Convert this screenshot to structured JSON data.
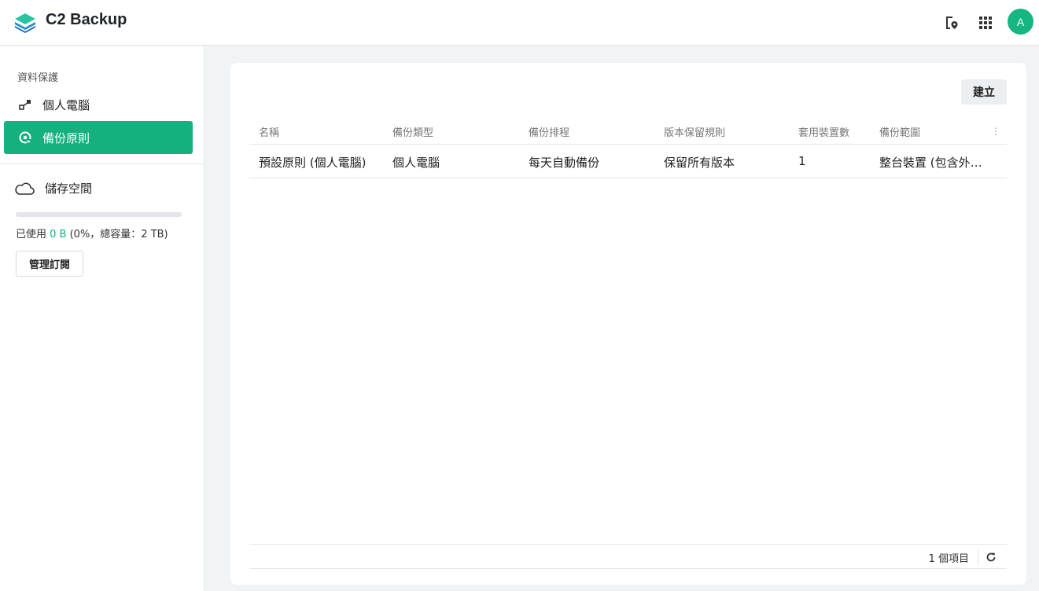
{
  "app": {
    "title": "C2 Backup"
  },
  "header": {
    "icons": [
      "file-location-icon",
      "apps-grid-icon"
    ],
    "avatar_letter": "A"
  },
  "sidebar": {
    "section_label": "資料保護",
    "items": [
      {
        "label": "個人電腦",
        "icon": "device-link-icon",
        "active": false
      },
      {
        "label": "備份原則",
        "icon": "policy-icon",
        "active": true
      }
    ],
    "storage": {
      "label": "儲存空間",
      "usage_prefix": "已使用 ",
      "usage_used": "0 B",
      "usage_suffix": " (0%，總容量：2 TB)",
      "usage_fraction": 0,
      "manage_label": "管理訂閱"
    }
  },
  "main": {
    "create_label": "建立",
    "columns": [
      "名稱",
      "備份類型",
      "備份排程",
      "版本保留規則",
      "套用裝置數",
      "備份範圍"
    ],
    "rows": [
      {
        "name": "預設原則 (個人電腦)",
        "type": "個人電腦",
        "schedule": "每天自動備份",
        "retention": "保留所有版本",
        "devices": "1",
        "scope": "整台裝置 (包含外接…"
      }
    ],
    "footer": {
      "count": "1 個項目"
    }
  },
  "colors": {
    "accent": "#14b07f",
    "header_bg": "#ffffff",
    "page_bg": "#f1f3f5"
  }
}
